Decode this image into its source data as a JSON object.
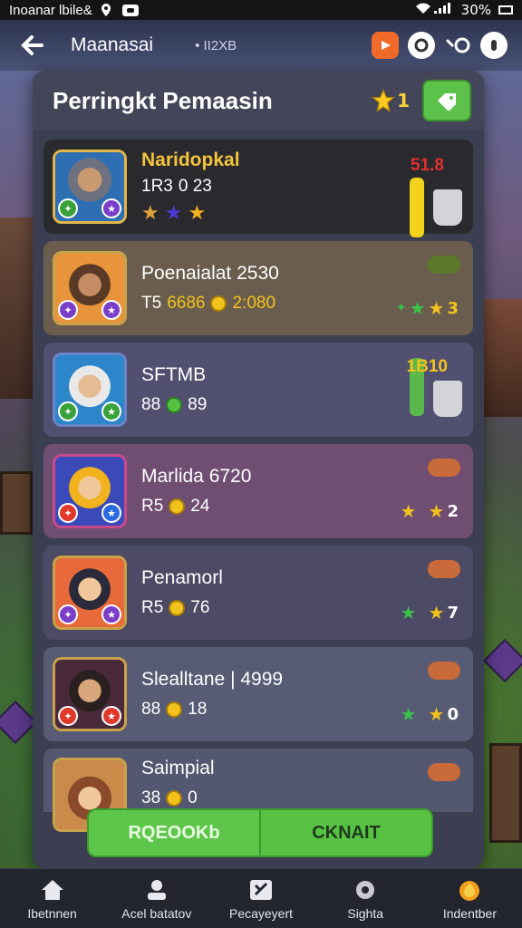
{
  "status_bar": {
    "carrier": "Inoanar lbile&",
    "battery": "30%"
  },
  "topbar": {
    "title": "Maanasai",
    "subtitle": "• II2XB"
  },
  "panel": {
    "title": "Perringkt Pemaasin",
    "star_count": "1"
  },
  "rows": [
    {
      "name": "Naridopkal",
      "stats_a": "1R3",
      "stats_b": "0 23",
      "right_value": "51.8"
    },
    {
      "name": "Poenaialat 2530",
      "stats_a": "T5",
      "stats_b": "6686",
      "stats_c": "2:080",
      "right_value": "3"
    },
    {
      "name": "SFTMB",
      "stats_a": "88",
      "stats_b": "89",
      "right_value": "1B10"
    },
    {
      "name": "Marlida 6720",
      "stats_a": "R5",
      "stats_b": "24",
      "right_value": "2"
    },
    {
      "name": "Penamorl",
      "stats_a": "R5",
      "stats_b": "76",
      "right_value": "7"
    },
    {
      "name": "Slealltane | 4999",
      "stats_a": "88",
      "stats_b": "18",
      "right_value": "0"
    },
    {
      "name": "Saimpial",
      "stats_a": "38",
      "stats_b": "0",
      "right_value": ""
    }
  ],
  "actions": {
    "left_label": "RQEOOKb",
    "right_label": "CKNAIT"
  },
  "nav": [
    {
      "label": "Ibetnnen"
    },
    {
      "label": "Acel batatov"
    },
    {
      "label": "Pecayeyert"
    },
    {
      "label": "Sighta"
    },
    {
      "label": "Indentber"
    }
  ],
  "colors": {
    "accent_green": "#5ec64a",
    "gold": "#f2c21c",
    "panel": "#3c3f51"
  }
}
